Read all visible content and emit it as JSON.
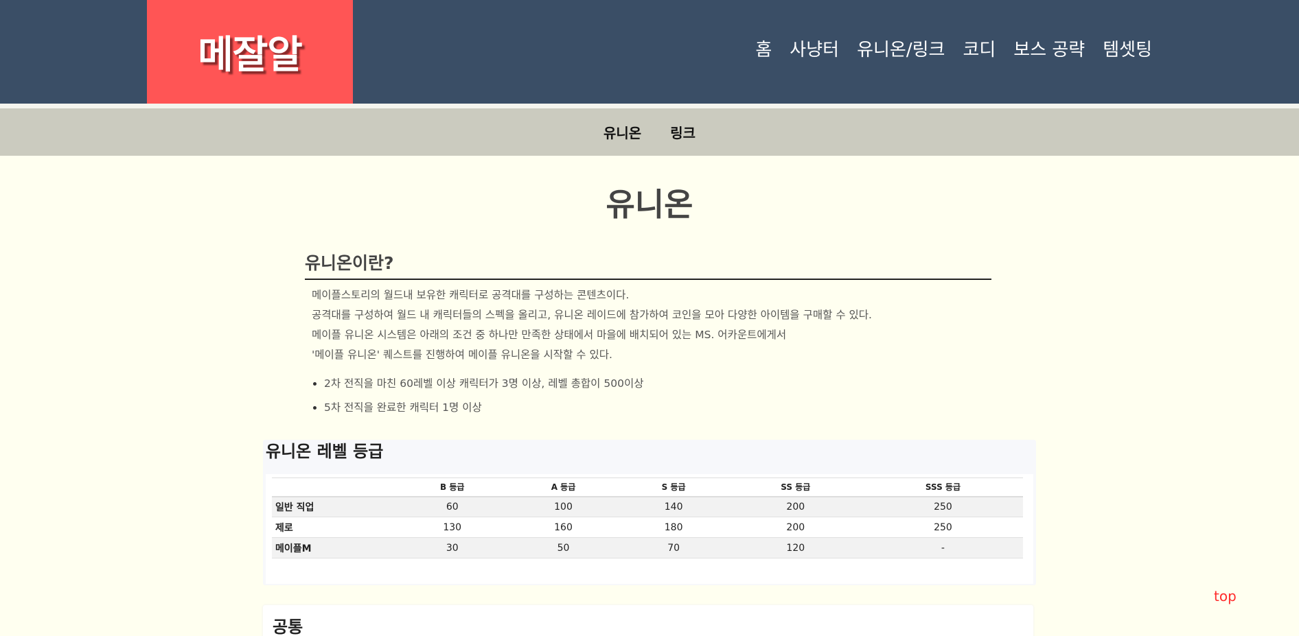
{
  "header": {
    "logo": "메잘알",
    "nav": [
      "홈",
      "사냥터",
      "유니온/링크",
      "코디",
      "보스 공략",
      "템셋팅"
    ]
  },
  "subnav": [
    "유니온",
    "링크"
  ],
  "page_title": "유니온",
  "intro_section": {
    "title": "유니온이란?",
    "paragraphs": [
      "메이플스토리의 월드내 보유한 캐릭터로 공격대를 구성하는 콘텐츠이다.",
      "공격대를 구성하여 월드 내 캐릭터들의 스펙을 올리고, 유니온 레이드에 참가하여 코인을 모아 다양한 아이템을 구매할 수 있다.",
      "메이플 유니온 시스템은 아래의 조건 중 하나만 만족한 상태에서 마을에 배치되어 있는 MS. 어카운트에게서",
      "'메이플 유니온' 퀘스트를 진행하여 메이플 유니온을 시작할 수 있다."
    ],
    "bullets": [
      "2차 전직을 마친 60레벨 이상 캐릭터가 3명 이상, 레벨 총합이 500이상",
      "5차 전직을 완료한 캐릭터 1명 이상"
    ]
  },
  "grade_table": {
    "title": "유니온 레벨 등급",
    "headers": [
      "",
      "B 등급",
      "A 등급",
      "S 등급",
      "SS 등급",
      "SSS 등급"
    ],
    "rows": [
      [
        "일반 직업",
        "60",
        "100",
        "140",
        "200",
        "250"
      ],
      [
        "제로",
        "130",
        "160",
        "180",
        "200",
        "250"
      ],
      [
        "메이플M",
        "30",
        "50",
        "70",
        "120",
        "-"
      ]
    ]
  },
  "common_section": {
    "title": "공통"
  },
  "top_link": "top",
  "colors": {
    "header_bg": "#3a4e66",
    "logo_bg": "#ff5555",
    "subnav_bg": "#cbcbbf",
    "page_bg": "#fffff0",
    "top_link": "#ff2a2a"
  }
}
